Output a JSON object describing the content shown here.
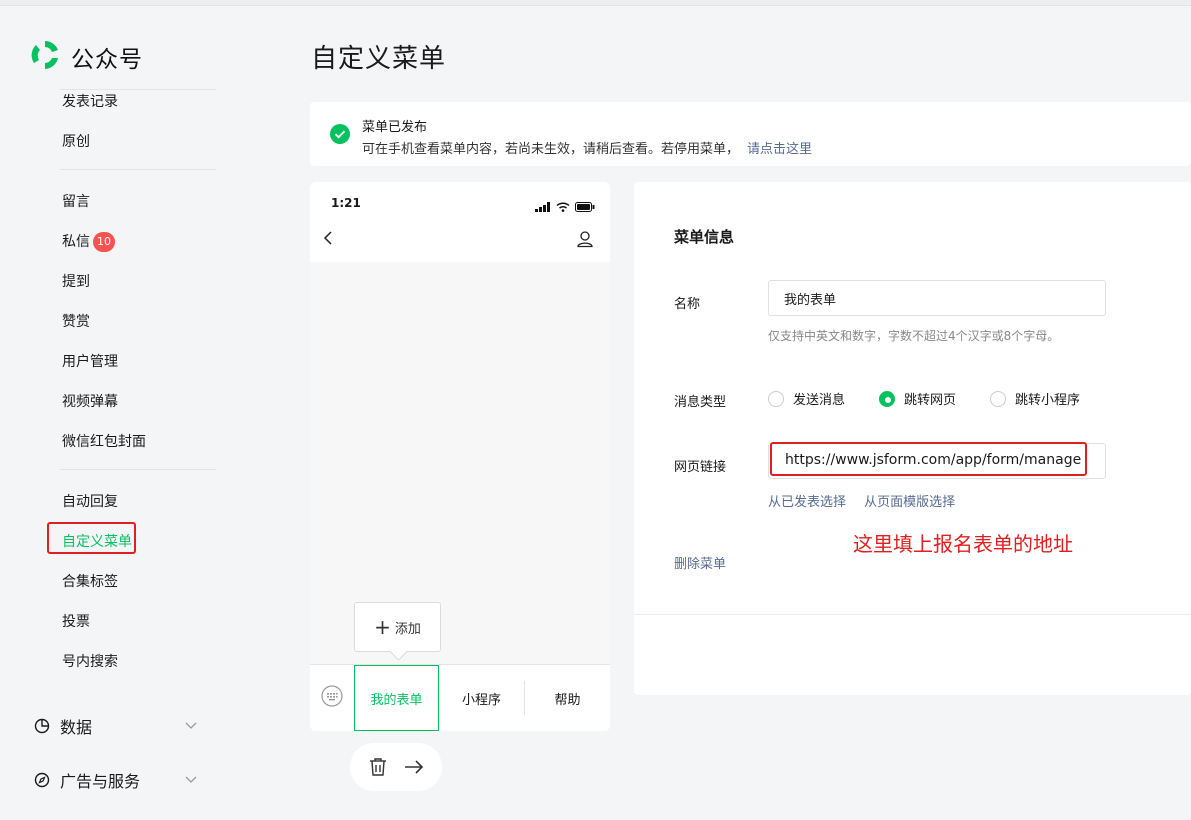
{
  "app": {
    "name": "公众号"
  },
  "sidebar": {
    "items": [
      {
        "label": "发表记录"
      },
      {
        "label": "原创"
      },
      {
        "label": "留言"
      },
      {
        "label": "私信",
        "badge": "10"
      },
      {
        "label": "提到"
      },
      {
        "label": "赞赏"
      },
      {
        "label": "用户管理"
      },
      {
        "label": "视频弹幕"
      },
      {
        "label": "微信红包封面"
      },
      {
        "label": "自动回复"
      },
      {
        "label": "自定义菜单"
      },
      {
        "label": "合集标签"
      },
      {
        "label": "投票"
      },
      {
        "label": "号内搜索"
      }
    ],
    "groups": [
      {
        "label": "数据"
      },
      {
        "label": "广告与服务"
      }
    ]
  },
  "page": {
    "title": "自定义菜单"
  },
  "notice": {
    "title": "菜单已发布",
    "desc": "可在手机查看菜单内容，若尚未生效，请稍后查看。若停用菜单，",
    "link": "请点击这里"
  },
  "phone": {
    "time": "1:21",
    "add_label": "添加",
    "menu": [
      {
        "label": "我的表单",
        "selected": true
      },
      {
        "label": "小程序"
      },
      {
        "label": "帮助"
      }
    ]
  },
  "editor": {
    "heading": "菜单信息",
    "name_label": "名称",
    "name_value": "我的表单",
    "name_hint": "仅支持中英文和数字，字数不超过4个汉字或8个字母。",
    "type_label": "消息类型",
    "type_options": [
      {
        "label": "发送消息",
        "checked": false
      },
      {
        "label": "跳转网页",
        "checked": true
      },
      {
        "label": "跳转小程序",
        "checked": false
      }
    ],
    "url_label": "网页链接",
    "url_value": "https://www.jsform.com/app/form/manage",
    "link_published": "从已发表选择",
    "link_template": "从页面模版选择",
    "delete_label": "删除菜单"
  },
  "annotation": {
    "text": "这里填上报名表单的地址"
  },
  "colors": {
    "accent": "#07c160",
    "link": "#576b95",
    "badge": "#fa5151",
    "highlight": "#e02020"
  }
}
